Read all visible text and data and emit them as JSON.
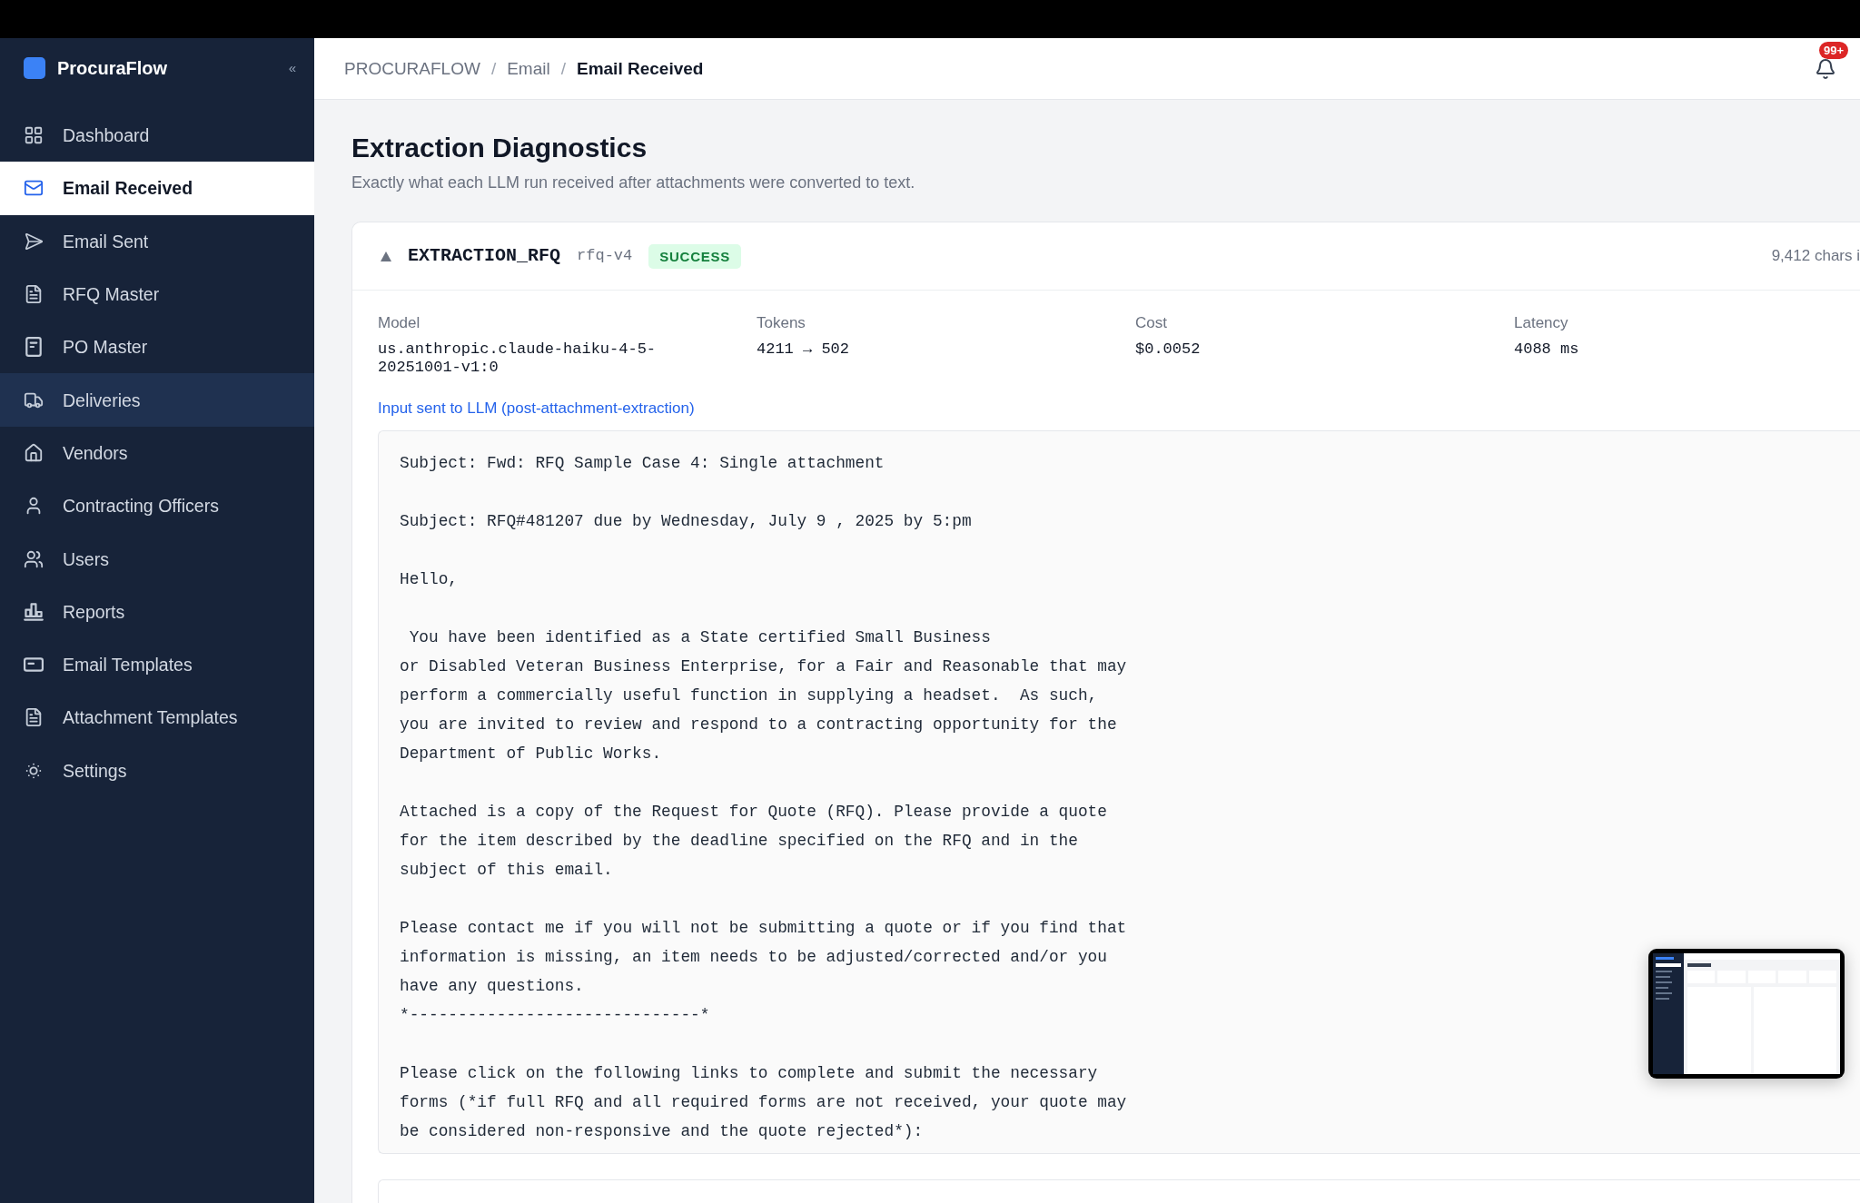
{
  "sidebar": {
    "brand": "ProcuraFlow",
    "collapse_button": "«",
    "items": [
      {
        "label": "Dashboard",
        "selected": false,
        "hovered": false
      },
      {
        "label": "Email Received",
        "selected": true,
        "hovered": false
      },
      {
        "label": "Email Sent",
        "selected": false,
        "hovered": false
      },
      {
        "label": "RFQ Master",
        "selected": false,
        "hovered": false
      },
      {
        "label": "PO Master",
        "selected": false,
        "hovered": false
      },
      {
        "label": "Deliveries",
        "selected": false,
        "hovered": true
      },
      {
        "label": "Vendors",
        "selected": false,
        "hovered": false
      },
      {
        "label": "Contracting Officers",
        "selected": false,
        "hovered": false
      },
      {
        "label": "Users",
        "selected": false,
        "hovered": false
      },
      {
        "label": "Reports",
        "selected": false,
        "hovered": false
      },
      {
        "label": "Email Templates",
        "selected": false,
        "hovered": false
      },
      {
        "label": "Attachment Templates",
        "selected": false,
        "hovered": false
      },
      {
        "label": "Settings",
        "selected": false,
        "hovered": false
      }
    ]
  },
  "header": {
    "breadcrumbs": [
      {
        "label": "PROCURAFLOW",
        "current": false
      },
      {
        "label": "Email",
        "current": false
      },
      {
        "label": "Email Received",
        "current": true
      }
    ],
    "separators": [
      "/",
      "/"
    ],
    "notifications": {
      "badge": "99+"
    }
  },
  "page": {
    "title": "Extraction Diagnostics",
    "subtitle": "Exactly what each LLM run received after attachments were converted to text."
  },
  "run": {
    "expanded": true,
    "name": "EXTRACTION_RFQ",
    "version": "rfq-v4",
    "status": {
      "label": "SUCCESS",
      "kind": "success"
    },
    "input_size": "9,412 chars i",
    "metrics": [
      {
        "label": "Model",
        "value": "us.anthropic.claude-haiku-4-5-20251001-v1:0"
      },
      {
        "label": "Tokens",
        "value": "4211 → 502"
      },
      {
        "label": "Cost",
        "value": "$0.0052"
      },
      {
        "label": "Latency",
        "value": "4088 ms"
      }
    ],
    "input_link": "Input sent to LLM (post-attachment-extraction)",
    "input_text": "Subject: Fwd: RFQ Sample Case 4: Single attachment\n\nSubject: RFQ#481207 due by Wednesday, July 9 , 2025 by 5:pm\n\nHello,\n\n You have been identified as a State certified Small Business\nor Disabled Veteran Business Enterprise, for a Fair and Reasonable that may\nperform a commercially useful function in supplying a headset.  As such,\nyou are invited to review and respond to a contracting opportunity for the\nDepartment of Public Works.\n\nAttached is a copy of the Request for Quote (RFQ). Please provide a quote\nfor the item described by the deadline specified on the RFQ and in the\nsubject of this email.\n\nPlease contact me if you will not be submitting a quote or if you find that\ninformation is missing, an item needs to be adjusted/corrected and/or you\nhave any questions.\n*------------------------------*\n\nPlease click on the following links to complete and submit the necessary\nforms (*if full RFQ and all required forms are not received, your quote may\nbe considered non-responsive and the quote rejected*):"
  }
}
